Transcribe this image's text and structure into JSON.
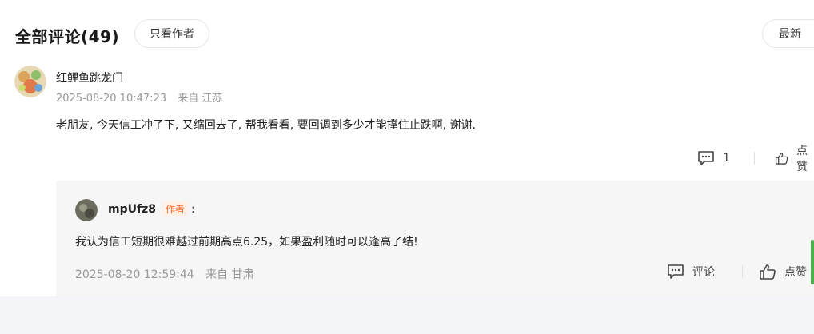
{
  "header": {
    "title": "全部评论(49)",
    "author_only_label": "只看作者",
    "sort_label": "最新"
  },
  "comment": {
    "username": "红鲤鱼跳龙门",
    "timestamp": "2025-08-20 10:47:23",
    "location": "来自 江苏",
    "content": "老朋友, 今天信工冲了下, 又缩回去了, 帮我看看, 要回调到多少才能撑住止跌啊, 谢谢.",
    "reply_count": "1",
    "like_label": "点赞",
    "reply_icon": "comment-icon",
    "like_icon": "thumbs-up-icon"
  },
  "reply": {
    "username": "mpUfz8",
    "author_tag": "作者",
    "colon": ":",
    "content": "我认为信工短期很难越过前期高点6.25，如果盈利随时可以逢高了结!",
    "timestamp": "2025-08-20 12:59:44",
    "location": "来自 甘肃",
    "comment_label": "评论",
    "like_label": "点赞"
  },
  "colors": {
    "author_tag": "#ff6a2a",
    "reply_bg": "#f6f6f7",
    "meta_text": "#999999"
  }
}
